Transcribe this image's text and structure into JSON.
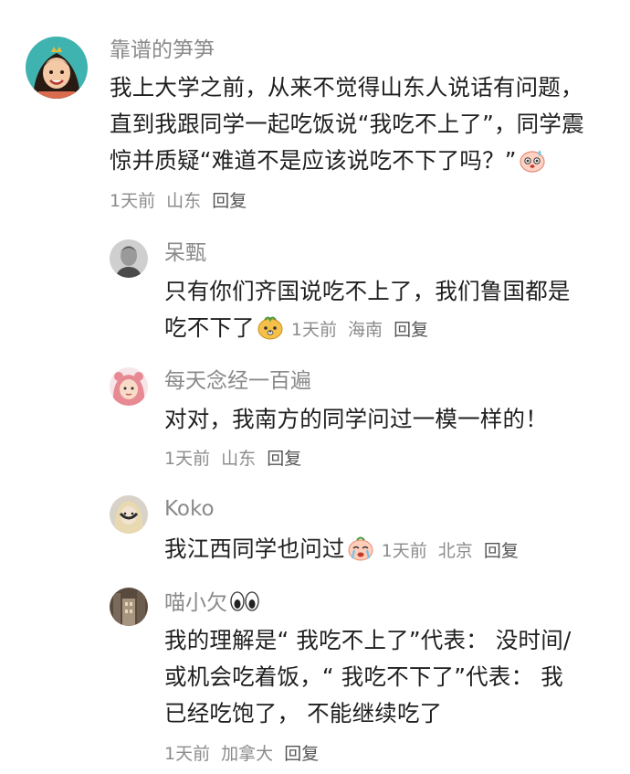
{
  "comments": [
    {
      "username": "靠谱的笋笋",
      "lines": [
        "我上大学之前，从来不觉得山东人说话有问题，",
        "直到我跟同学一起吃饭说“我吃不上了”，同学震",
        "惊并质疑“难道不是应该说吃不下了吗？”"
      ],
      "emoji": "sweating-blob-emoji",
      "time": "1天前",
      "location": "山东",
      "reply": "回复"
    }
  ],
  "replies": [
    {
      "username": "呆甄",
      "lines": [
        "只有你们齐国说吃不上了，我们鲁国都是",
        "吃不下了"
      ],
      "emoji": "dog-face-emoji",
      "time": "1天前",
      "location": "海南",
      "reply": "回复"
    },
    {
      "username": "每天念经一百遍",
      "lines": [
        "对对，我南方的同学问过一模一样的！"
      ],
      "time": "1天前",
      "location": "山东",
      "reply": "回复"
    },
    {
      "username": "Koko",
      "lines": [
        "我江西同学也问过"
      ],
      "emoji": "crying-blob-emoji",
      "time": "1天前",
      "location": "北京",
      "reply": "回复"
    },
    {
      "username": "喵小欠",
      "username_emoji": "eyes-emoji",
      "lines": [
        "我的理解是“ 我吃不上了”代表： 没时间/",
        "或机会吃着饭，“ 我吃不下了”代表： 我",
        "已经吃饱了， 不能继续吃了"
      ],
      "time": "1天前",
      "location": "加拿大",
      "reply": "回复"
    }
  ],
  "colors": {
    "username": "#8a8a8a",
    "body": "#1f1f1f",
    "meta": "#8c8c8c"
  }
}
